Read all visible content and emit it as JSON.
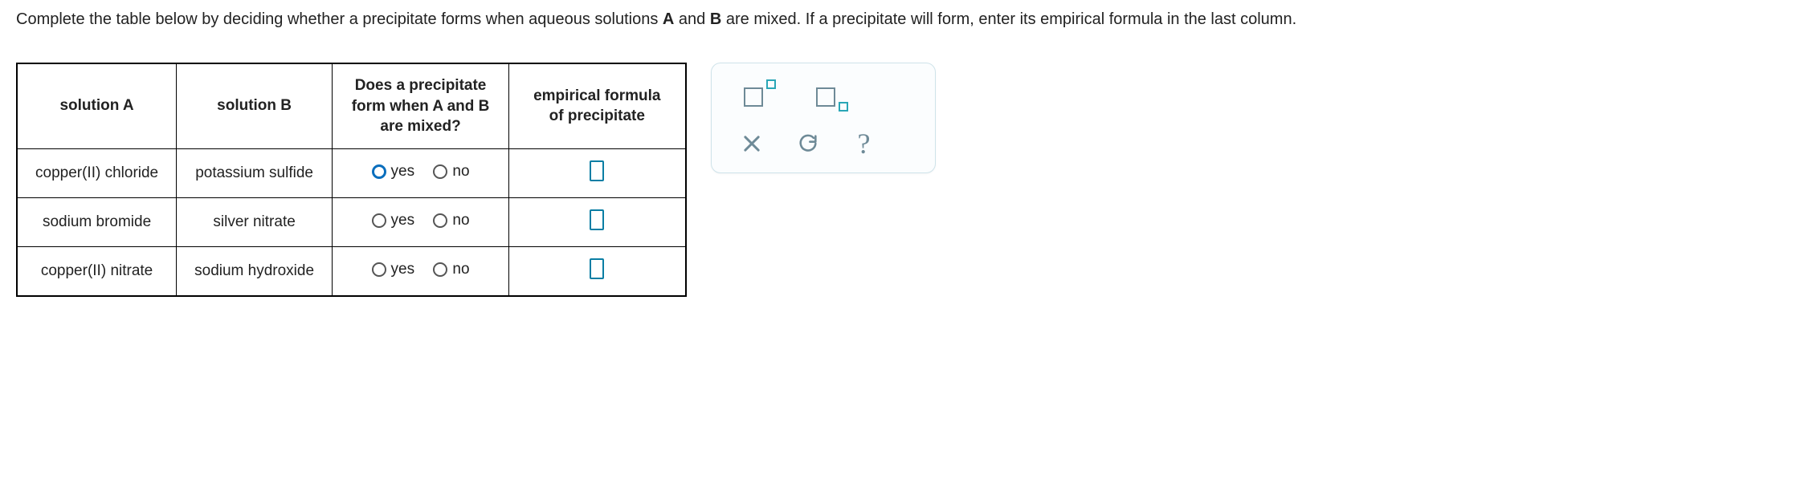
{
  "instructions": {
    "prefix": "Complete the table below by deciding whether a precipitate forms when aqueous solutions ",
    "a": "A",
    "mid1": " and ",
    "b": "B",
    "suffix": " are mixed. If a precipitate will form, enter its empirical formula in the last column."
  },
  "headers": {
    "solA": "solution A",
    "solB": "solution B",
    "question": "Does a precipitate form when A and B are mixed?",
    "formula": "empirical formula of precipitate"
  },
  "rows": [
    {
      "a": "copper(II) chloride",
      "b": "potassium sulfide",
      "yes": "yes",
      "no": "no",
      "focused": true
    },
    {
      "a": "sodium bromide",
      "b": "silver nitrate",
      "yes": "yes",
      "no": "no",
      "focused": false
    },
    {
      "a": "copper(II) nitrate",
      "b": "sodium hydroxide",
      "yes": "yes",
      "no": "no",
      "focused": false
    }
  ],
  "toolbox": {
    "close": "×",
    "reset": "↺",
    "help": "?"
  }
}
